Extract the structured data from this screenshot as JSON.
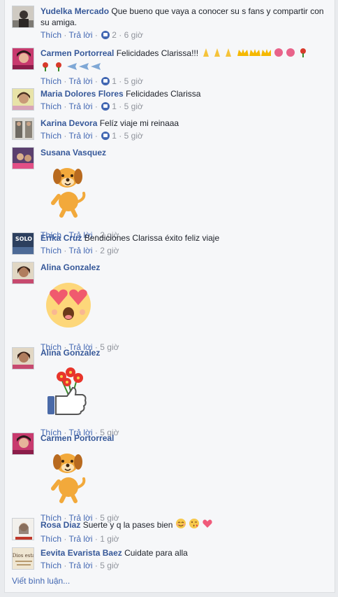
{
  "actions": {
    "like": "Thích",
    "reply": "Trả lời",
    "sep": "·"
  },
  "comments": [
    {
      "author": "Yudelka Mercado",
      "text": "Que bueno que vaya a conocer su s fans y compartir con su amiga.",
      "likes": "2",
      "time": "6 giờ"
    },
    {
      "author": "Carmen Portorreal",
      "text": "Felicidades Clarissa!!!",
      "likes": "1",
      "time": "5 giờ"
    },
    {
      "author": "Maria Dolores Flores",
      "text": "Felicidades Clarissa",
      "likes": "1",
      "time": "5 giờ"
    },
    {
      "author": "Karina Devora",
      "text": "Felíz viaje mi reinaaa",
      "likes": "1",
      "time": "5 giờ"
    },
    {
      "author": "Susana Vasquez",
      "sticker": "dog-sticker",
      "time": "2 giờ"
    },
    {
      "author": "Erika Cruz",
      "text": "Bendiciones Clarissa éxito feliz viaje",
      "time": "2 giờ"
    },
    {
      "author": "Alina Gonzalez",
      "sticker": "heart-eyes-sticker",
      "time": "5 giờ"
    },
    {
      "author": "Alina Gonzalez",
      "sticker": "flowers-thumbs-up-sticker",
      "time": "5 giờ"
    },
    {
      "author": "Carmen Portorreal",
      "sticker": "dog-sticker",
      "time": "5 giờ"
    },
    {
      "author": "Rosa Diaz",
      "text": "Suerte y q la pases bien",
      "time": "1 giờ"
    },
    {
      "author": "Eevita Evarista Baez",
      "text": "Cuidate para alla",
      "time": "5 giờ"
    }
  ],
  "avatar_labels": {
    "c6": "SOLO",
    "c11": "Dios está"
  },
  "write_comment": "Viết bình luận...",
  "colors": {
    "author": "#365899",
    "link": "#4267b2",
    "meta": "#90949c",
    "bg": "#f6f7f9"
  }
}
